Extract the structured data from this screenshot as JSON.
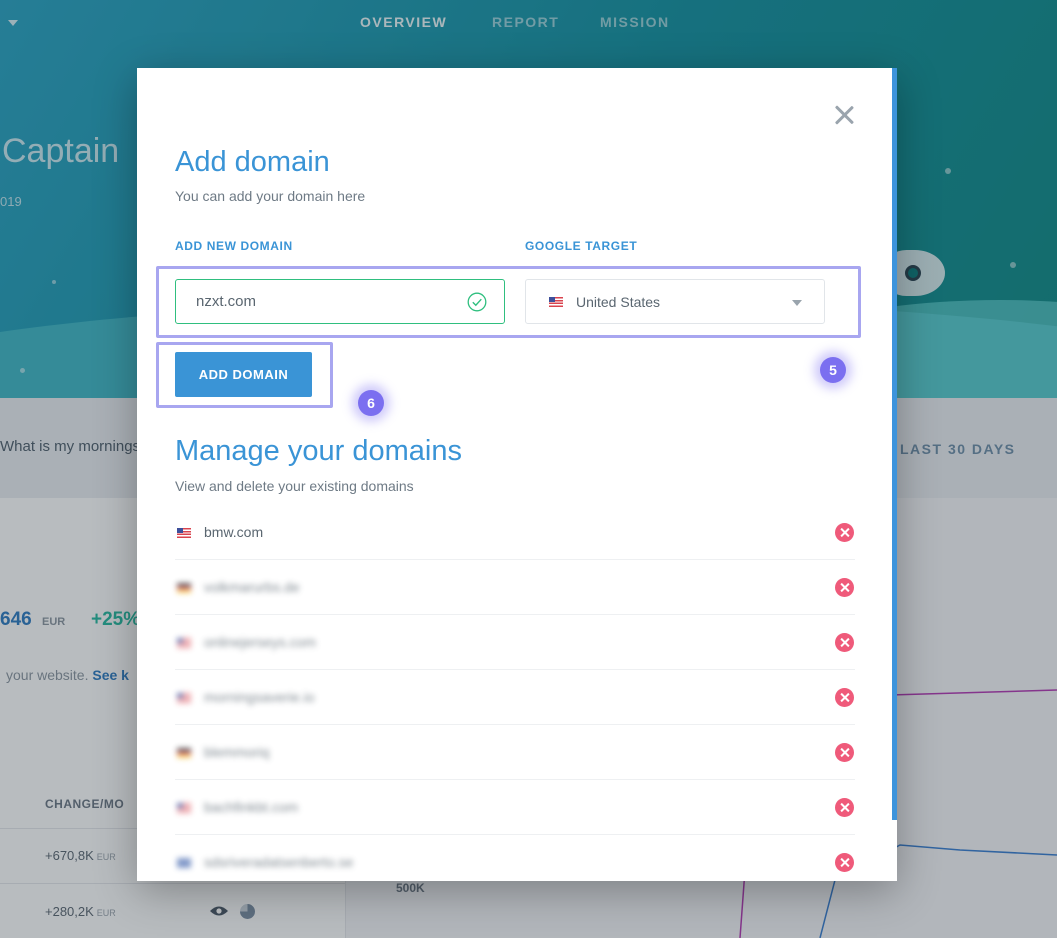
{
  "nav": {
    "overview": "OVERVIEW",
    "report": "REPORT",
    "mission": "MISSION"
  },
  "hero": {
    "title": "Captain",
    "subtitle": "019"
  },
  "filter": {
    "query": "What is my mornings",
    "range": "LAST 30 DAYS"
  },
  "metrics": {
    "value": "646",
    "currency": "EUR",
    "change": "+25%",
    "note": "your website.",
    "note_link": "See k"
  },
  "table": {
    "header": "CHANGE/MO",
    "rows": [
      {
        "value": "+670,8K",
        "currency": "EUR"
      },
      {
        "value": "+280,2K",
        "currency": "EUR"
      }
    ]
  },
  "chart": {
    "axis_label": "500K"
  },
  "modal": {
    "title": "Add domain",
    "subtitle": "You can add your domain here",
    "domain_label": "ADD NEW DOMAIN",
    "domain_value": "nzxt.com",
    "target_label": "GOOGLE TARGET",
    "target_value": "United States",
    "add_button": "ADD DOMAIN",
    "manage_title": "Manage your domains",
    "manage_subtitle": "View and delete your existing domains",
    "domains": [
      {
        "name": "bmw.com",
        "flag": "us",
        "blurred": false
      },
      {
        "name": "volkmarurbs.de",
        "flag": "de",
        "blurred": true
      },
      {
        "name": "onlinejerseys.com",
        "flag": "us",
        "blurred": true
      },
      {
        "name": "morningsaverie.io",
        "flag": "us",
        "blurred": true
      },
      {
        "name": "blemmoriq",
        "flag": "de",
        "blurred": true
      },
      {
        "name": "bachfinkbt.com",
        "flag": "us",
        "blurred": true
      },
      {
        "name": "sdsriveradatsenberto.se",
        "flag": "eu",
        "blurred": true
      }
    ]
  },
  "tutorial": {
    "step5": "5",
    "step6": "6"
  },
  "colors": {
    "accent": "#3a94d6",
    "success": "#2fbf7f",
    "danger": "#ef5a7a",
    "highlight": "#a8a6f0",
    "badge": "#7b6ff0"
  }
}
